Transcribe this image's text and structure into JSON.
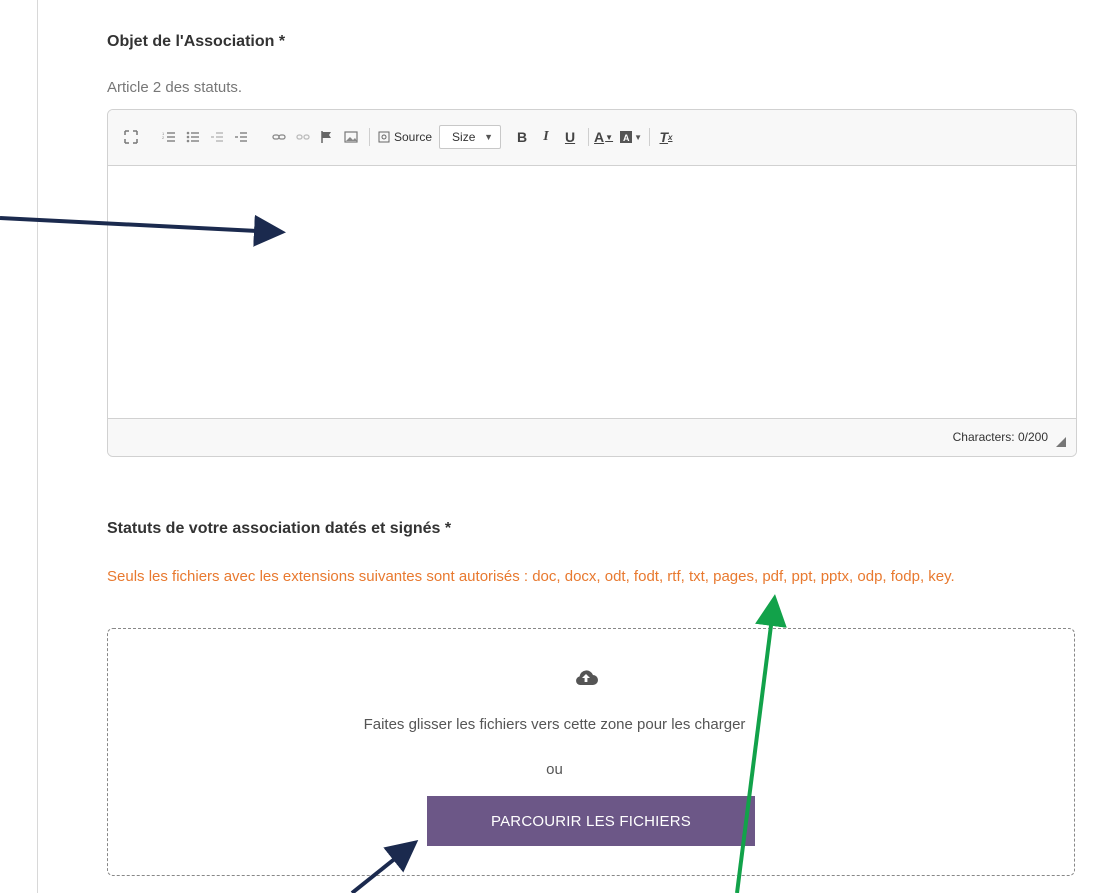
{
  "objet": {
    "label": "Objet de l'Association *",
    "help": "Article 2 des statuts."
  },
  "editor": {
    "toolbar": {
      "source_label": "Source",
      "size_label": "Size",
      "bold": "B",
      "italic": "I",
      "underline": "U",
      "font_color": "A",
      "remove_format": "T"
    },
    "content": "",
    "char_count": "Characters: 0/200"
  },
  "statuts": {
    "label": "Statuts de votre association datés et signés *",
    "extensions_note": "Seuls les fichiers avec les extensions suivantes sont autorisés : doc, docx, odt, fodt, rtf, txt, pages, pdf, ppt, pptx, odp, fodp, key."
  },
  "dropzone": {
    "icon": "cloud-upload-icon",
    "drag_text": "Faites glisser les fichiers vers cette zone pour les charger",
    "or_text": "ou",
    "browse_label": "PARCOURIR LES FICHIERS"
  },
  "colors": {
    "accent_button": "#6c5787",
    "warning_text": "#e8792f",
    "annotation_navy": "#1b2a4e",
    "annotation_green": "#12a24a"
  }
}
